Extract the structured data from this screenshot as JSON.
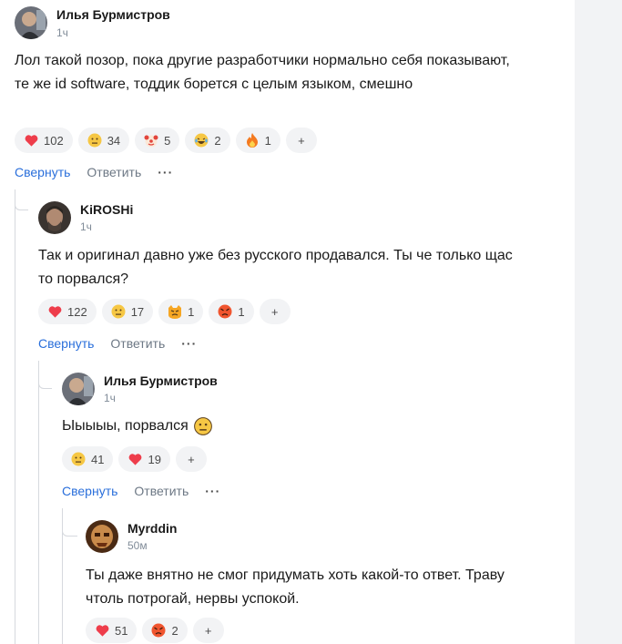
{
  "comments": [
    {
      "author": "Илья Бурмистров",
      "time": "1ч",
      "text": "Лол такой позор, пока другие разработчики нормально себя показывают, те же id software, тоддик борется с целым языком, смешно",
      "reactions": [
        {
          "icon": "heart-icon",
          "count": "102"
        },
        {
          "icon": "neutral-face-icon",
          "count": "34"
        },
        {
          "icon": "clown-face-icon",
          "count": "5"
        },
        {
          "icon": "laughing-face-icon",
          "count": "2"
        },
        {
          "icon": "fire-icon",
          "count": "1"
        }
      ]
    },
    {
      "author": "KiROSHi",
      "time": "1ч",
      "text": "Так и оригинал давно уже без русского продавался. Ты че только щас то порвался?",
      "reactions": [
        {
          "icon": "heart-icon",
          "count": "122"
        },
        {
          "icon": "neutral-face-icon",
          "count": "17"
        },
        {
          "icon": "angry-cat-icon",
          "count": "1"
        },
        {
          "icon": "angry-face-icon",
          "count": "1"
        }
      ]
    },
    {
      "author": "Илья Бурмистров",
      "time": "1ч",
      "text": "Ыыыыы, порвался",
      "reactions": [
        {
          "icon": "neutral-face-icon",
          "count": "41"
        },
        {
          "icon": "heart-icon",
          "count": "19"
        }
      ]
    },
    {
      "author": "Myrddin",
      "time": "50м",
      "text": "Ты даже внятно не смог придумать хоть какой-то ответ. Траву чтоль потрогай, нервы успокой.",
      "reactions": [
        {
          "icon": "heart-icon",
          "count": "51"
        },
        {
          "icon": "angry-face-icon",
          "count": "2"
        }
      ]
    }
  ],
  "actions": {
    "collapse": "Свернуть",
    "reply": "Ответить",
    "more": "···"
  },
  "add_reaction": "+",
  "colors": {
    "link": "#2a6fdb",
    "muted": "#818c99",
    "chip_bg": "#f2f3f5",
    "thread_line": "#d6d9de"
  }
}
